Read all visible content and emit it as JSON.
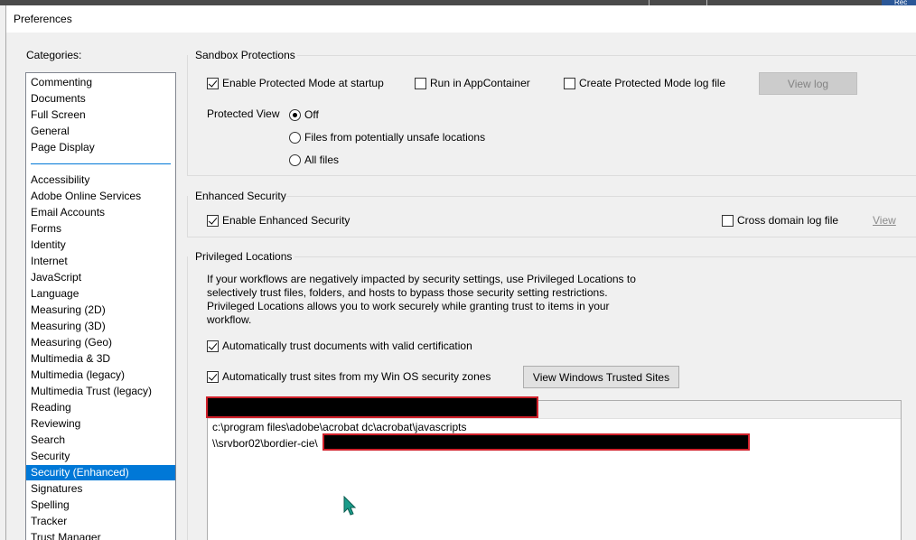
{
  "window": {
    "title": "Preferences"
  },
  "background": {
    "right_fragment": "Rec"
  },
  "categories": {
    "label": "Categories:",
    "group1": [
      "Commenting",
      "Documents",
      "Full Screen",
      "General",
      "Page Display"
    ],
    "group2": [
      "Accessibility",
      "Adobe Online Services",
      "Email Accounts",
      "Forms",
      "Identity",
      "Internet",
      "JavaScript",
      "Language",
      "Measuring (2D)",
      "Measuring (3D)",
      "Measuring (Geo)",
      "Multimedia & 3D",
      "Multimedia (legacy)",
      "Multimedia Trust (legacy)",
      "Reading",
      "Reviewing",
      "Search",
      "Security",
      "Security (Enhanced)",
      "Signatures",
      "Spelling",
      "Tracker",
      "Trust Manager"
    ],
    "selected": "Security (Enhanced)"
  },
  "sandbox": {
    "title": "Sandbox Protections",
    "protected_mode": {
      "label": "Enable Protected Mode at startup",
      "checked": true
    },
    "app_container": {
      "label": "Run in AppContainer",
      "checked": false
    },
    "log_file": {
      "label": "Create Protected Mode log file",
      "checked": false
    },
    "view_log_button": "View log",
    "protected_view_label": "Protected View",
    "pv_off": "Off",
    "pv_unsafe": "Files from potentially unsafe locations",
    "pv_all": "All files",
    "pv_selected": "Off"
  },
  "enhanced": {
    "title": "Enhanced Security",
    "enable": {
      "label": "Enable Enhanced Security",
      "checked": true
    },
    "cross_domain": {
      "label": "Cross domain log file",
      "checked": false
    },
    "view_link": "View"
  },
  "privileged": {
    "title": "Privileged Locations",
    "description": "If your workflows are negatively impacted by security settings, use Privileged Locations to selectively trust files, folders, and hosts to bypass those security setting restrictions. Privileged Locations allows you to work securely while granting trust to items in your workflow.",
    "trust_cert": {
      "label": "Automatically trust documents with valid certification",
      "checked": true
    },
    "trust_sites": {
      "label": "Automatically trust sites from my Win OS security zones",
      "checked": true
    },
    "view_trusted_button": "View Windows Trusted Sites",
    "locations": [
      "c:\\program files\\adobe\\acrobat dc\\acrobat\\javascripts",
      "\\\\srvbor02\\bordier-cie\\"
    ]
  },
  "colors": {
    "selection": "#0078d7",
    "redaction_border": "#d0202a"
  }
}
